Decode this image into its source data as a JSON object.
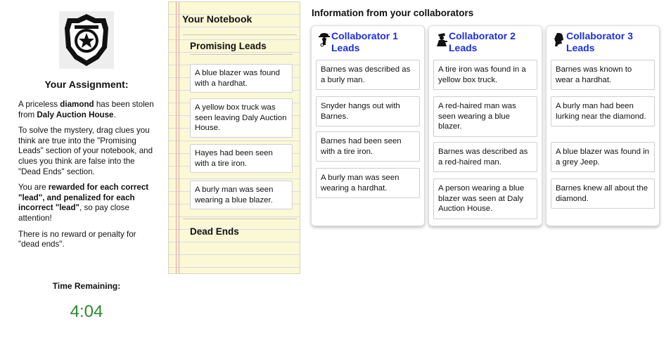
{
  "assignment": {
    "title": "Your Assignment:",
    "p1_a": "A priceless ",
    "p1_b": "diamond",
    "p1_c": " has been stolen from ",
    "p1_d": "Daly Auction House",
    "p1_e": ".",
    "p2": "To solve the mystery, drag clues you think are true into the \"Promising Leads\" section of your notebook, and clues you think are false into the \"Dead Ends\" section.",
    "p3_a": "You are ",
    "p3_b": "rewarded for each correct \"lead\", and penalized for each incorrect \"lead\"",
    "p3_c": ", so pay close attention!",
    "p4": "There is no reward or penalty for \"dead ends\".",
    "badge_icon": "police-badge-icon"
  },
  "timer": {
    "label": "Time Remaining:",
    "value": "4:04",
    "color": "#2a8a2a"
  },
  "notebook": {
    "title": "Your Notebook",
    "promising_title": "Promising Leads",
    "dead_title": "Dead Ends",
    "leads": [
      "A blue blazer was found with a hardhat.",
      "A yellow box truck was seen leaving Daly Auction House.",
      "Hayes had been seen with a tire iron.",
      "A burly man was seen wearing a blue blazer."
    ]
  },
  "collaborators": {
    "heading": "Information from your collaborators",
    "title_color": "#1a2ee8",
    "list": [
      {
        "title": "Collaborator 1 Leads",
        "icon": "detective-hat-icon",
        "clues": [
          "Barnes was described as a burly man.",
          "Snyder hangs out with Barnes.",
          "Barnes had been seen with a tire iron.",
          "A burly man was seen wearing a hardhat."
        ]
      },
      {
        "title": "Collaborator 2 Leads",
        "icon": "spy-figure-icon",
        "clues": [
          "A tire iron was found in a yellow box truck.",
          "A red-haired man was seen wearing a blue blazer.",
          "Barnes was described as a red-haired man.",
          "A person wearing a blue blazer was seen at Daly Auction House."
        ]
      },
      {
        "title": "Collaborator 3 Leads",
        "icon": "sherlock-profile-icon",
        "clues": [
          "Barnes was known to wear a hardhat.",
          "A burly man had been lurking near the diamond.",
          "A blue blazer was found in a grey Jeep.",
          "Barnes knew all about the diamond."
        ]
      }
    ]
  }
}
